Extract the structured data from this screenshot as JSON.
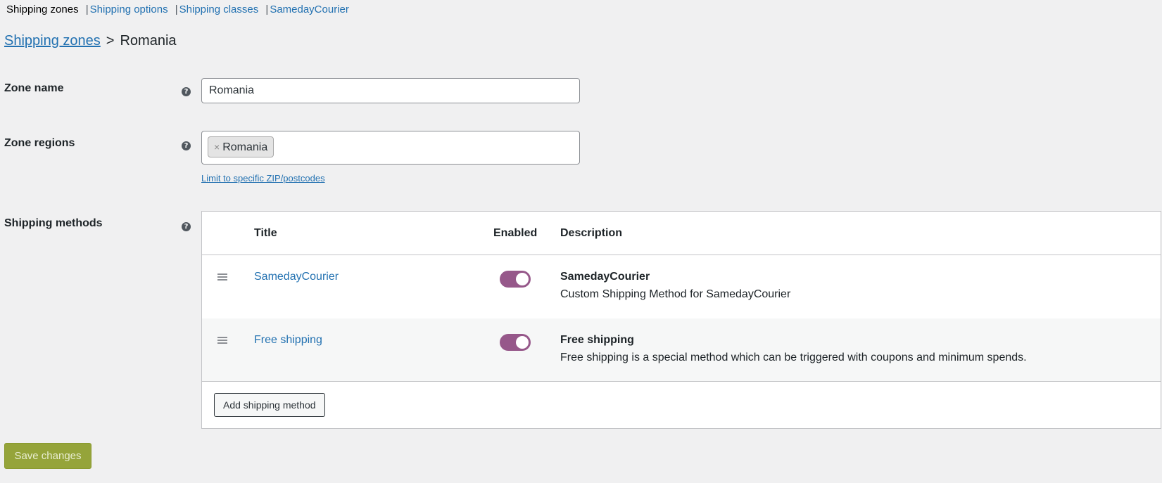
{
  "nav": {
    "current": "Shipping zones",
    "links": [
      "Shipping options",
      "Shipping classes",
      "SamedayCourier"
    ],
    "separator": "|"
  },
  "breadcrumb": {
    "root": "Shipping zones",
    "arrow": ">",
    "current": "Romania"
  },
  "zone_name": {
    "label": "Zone name",
    "help": "?",
    "value": "Romania"
  },
  "zone_regions": {
    "label": "Zone regions",
    "help": "?",
    "chip_remove": "×",
    "chip": "Romania",
    "limit_link": "Limit to specific ZIP/postcodes"
  },
  "shipping_methods": {
    "label": "Shipping methods",
    "help": "?",
    "headers": {
      "title": "Title",
      "enabled": "Enabled",
      "description": "Description"
    },
    "rows": [
      {
        "title": "SamedayCourier",
        "enabled": true,
        "desc_title": "SamedayCourier",
        "desc_text": "Custom Shipping Method for SamedayCourier"
      },
      {
        "title": "Free shipping",
        "enabled": true,
        "desc_title": "Free shipping",
        "desc_text": "Free shipping is a special method which can be triggered with coupons and minimum spends."
      }
    ],
    "add_button": "Add shipping method"
  },
  "save_button": "Save changes",
  "colors": {
    "link": "#2271b1",
    "toggle_on": "#96588a",
    "save_button": "#95a43a"
  }
}
